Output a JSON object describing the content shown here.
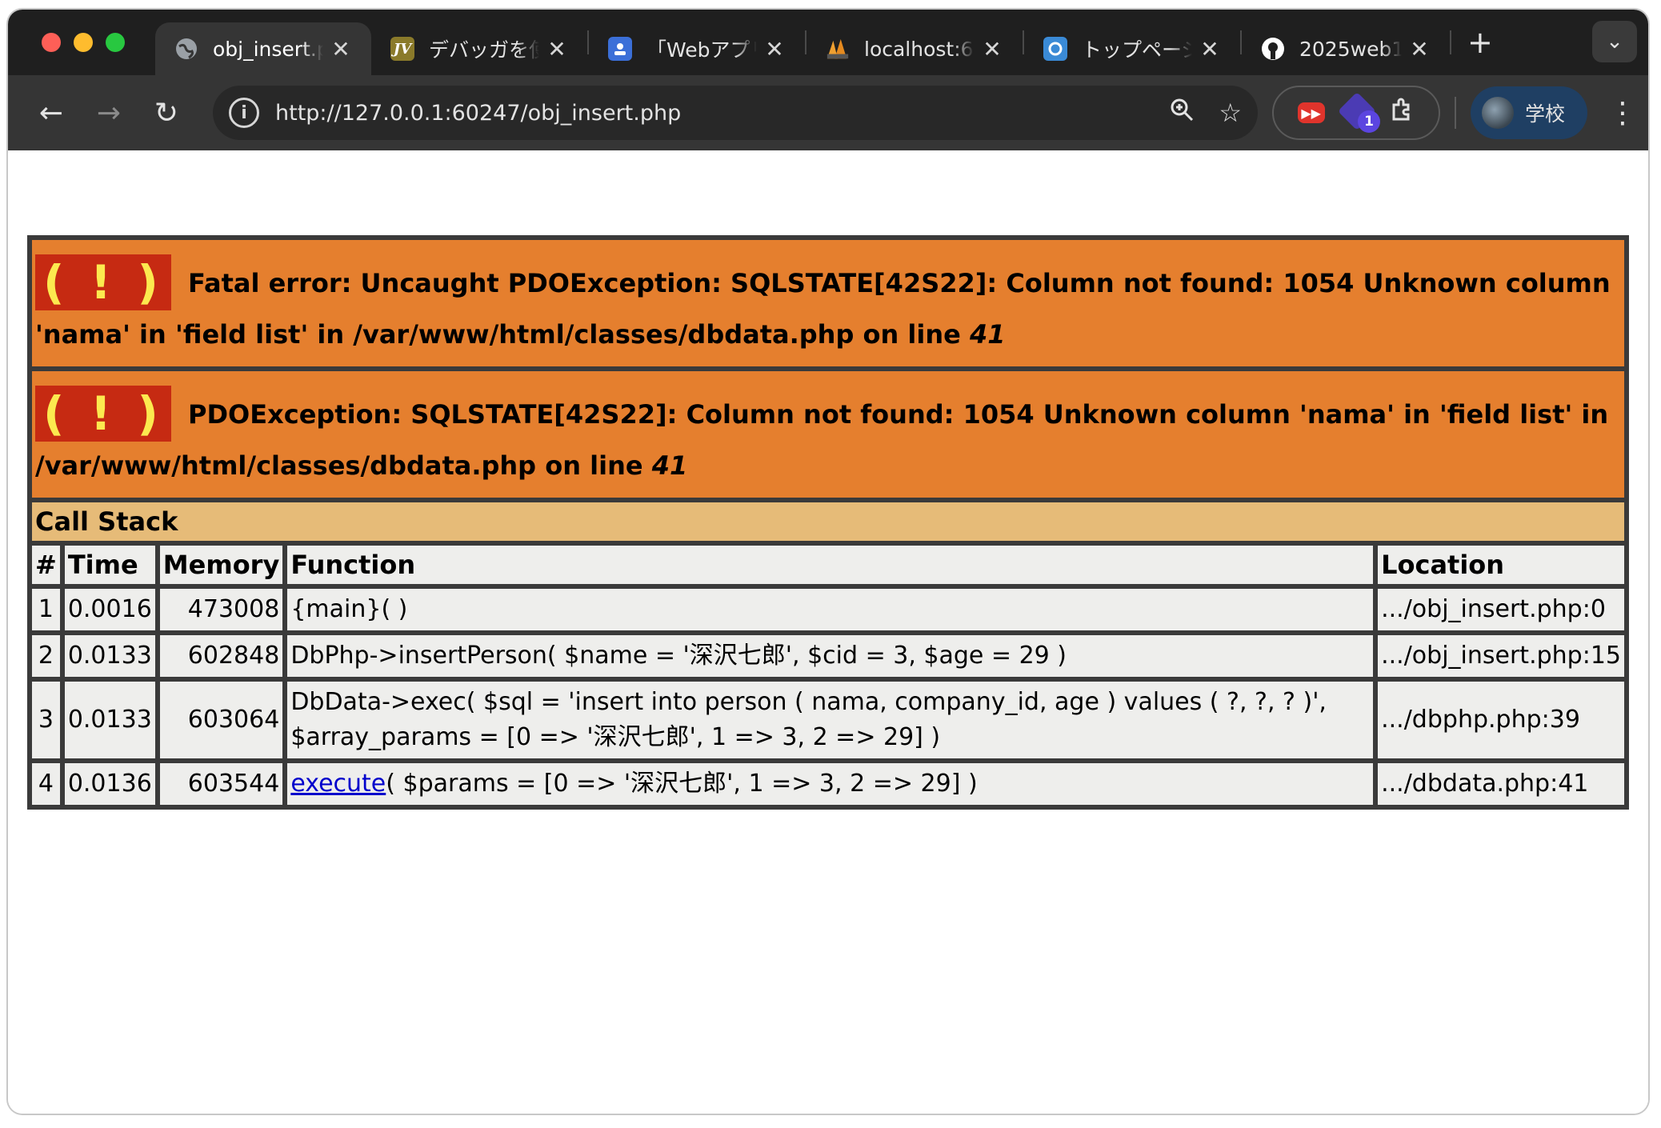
{
  "browser": {
    "tabs": [
      {
        "label": "obj_insert.p",
        "icon": "globe-icon",
        "active": true
      },
      {
        "label": "デバッガを使",
        "icon": "jv-icon",
        "active": false
      },
      {
        "label": "「Webアプリ",
        "icon": "contacts-icon",
        "active": false
      },
      {
        "label": "localhost:60",
        "icon": "phpmyadmin-icon",
        "active": false
      },
      {
        "label": "トップページ",
        "icon": "blue-circle-icon",
        "active": false
      },
      {
        "label": "2025web1-",
        "icon": "github-icon",
        "active": false
      }
    ],
    "url": "http://127.0.0.1:60247/obj_insert.php",
    "profile_label": "学校",
    "extension_badge": "1"
  },
  "error": {
    "fatal_text": "Fatal error: Uncaught PDOException: SQLSTATE[42S22]: Column not found: 1054 Unknown column 'nama' in 'field list' in /var/www/html/classes/dbdata.php on line",
    "fatal_line": "41",
    "exception_text": "PDOException: SQLSTATE[42S22]: Column not found: 1054 Unknown column 'nama' in 'field list' in /var/www/html/classes/dbdata.php on line",
    "exception_line": "41",
    "bang_symbol": "( ! )"
  },
  "call_stack": {
    "title": "Call Stack",
    "headers": [
      "#",
      "Time",
      "Memory",
      "Function",
      "Location"
    ],
    "rows": [
      {
        "n": "1",
        "time": "0.0016",
        "memory": "473008",
        "function": "{main}( )",
        "link": "",
        "location": ".../obj_insert.php:0"
      },
      {
        "n": "2",
        "time": "0.0133",
        "memory": "602848",
        "function": "DbPhp->insertPerson( $name = '深沢七郎', $cid = 3, $age = 29 )",
        "link": "",
        "location": ".../obj_insert.php:15"
      },
      {
        "n": "3",
        "time": "0.0133",
        "memory": "603064",
        "function": "DbData->exec( $sql = 'insert into person ( nama, company_id, age ) values ( ?, ?, ? )',",
        "function2": "$array_params = [0 => '深沢七郎', 1 => 3, 2 => 29] )",
        "link": "",
        "location": ".../dbphp.php:39"
      },
      {
        "n": "4",
        "time": "0.0136",
        "memory": "603544",
        "function": "( $params = [0 => '深沢七郎', 1 => 3, 2 => 29] )",
        "link": "execute",
        "location": ".../dbdata.php:41"
      }
    ]
  },
  "colors": {
    "error_bg": "#e57f2e",
    "bang_bg": "#c62a12",
    "bang_fg": "#fce94f",
    "callstack_bg": "#e6bb78",
    "row_bg": "#eeeeec"
  }
}
